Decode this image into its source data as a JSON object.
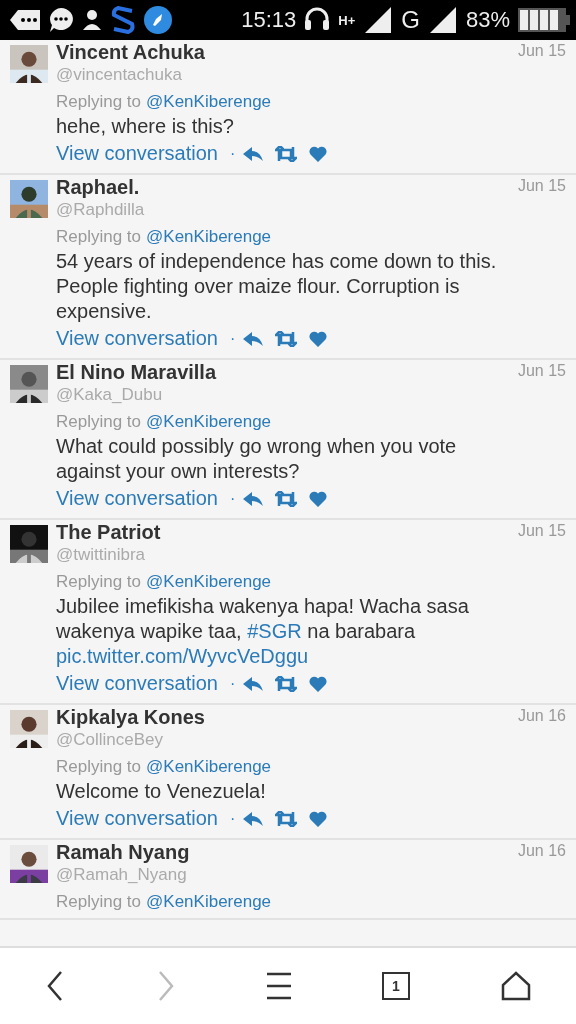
{
  "status_bar": {
    "time": "15:13",
    "network_plus": "H+",
    "network_g": "G",
    "battery": "83%"
  },
  "tweets": [
    {
      "name": "Vincent Achuka",
      "handle": "@vincentachuka",
      "date": "Jun 15",
      "replying_label": "Replying to",
      "replying_to": "@KenKiberenge",
      "body": [
        {
          "kind": "plain",
          "text": "hehe, where is this?"
        }
      ],
      "link": "View conversation"
    },
    {
      "name": "Raphael.",
      "handle": "@Raphdilla",
      "date": "Jun 15",
      "replying_label": "Replying to",
      "replying_to": "@KenKiberenge",
      "body": [
        {
          "kind": "plain",
          "text": "54 years of independence has come down to this. People fighting over maize flour. Corruption is expensive."
        }
      ],
      "link": "View conversation"
    },
    {
      "name": "El Nino Maravilla",
      "handle": "@Kaka_Dubu",
      "date": "Jun 15",
      "replying_label": "Replying to",
      "replying_to": "@KenKiberenge",
      "body": [
        {
          "kind": "plain",
          "text": "What could possibly go wrong when you vote against your own interests?"
        }
      ],
      "link": "View conversation"
    },
    {
      "name": "The Patriot",
      "handle": "@twittinibra",
      "date": "Jun 15",
      "replying_label": "Replying to",
      "replying_to": "@KenKiberenge",
      "body": [
        {
          "kind": "plain",
          "text": "Jubilee imefikisha wakenya hapa! Wacha sasa wakenya wapike taa, "
        },
        {
          "kind": "hashtag",
          "text": "#SGR"
        },
        {
          "kind": "plain",
          "text": " na barabara "
        },
        {
          "kind": "url",
          "text": "pic.twitter.com/WyvcVeDggu"
        }
      ],
      "link": "View conversation"
    },
    {
      "name": "Kipkalya Kones",
      "handle": "@CollinceBey",
      "date": "Jun 16",
      "replying_label": "Replying to",
      "replying_to": "@KenKiberenge",
      "body": [
        {
          "kind": "plain",
          "text": "Welcome to Venezuela!"
        }
      ],
      "link": "View conversation"
    },
    {
      "name": "Ramah Nyang",
      "handle": "@Ramah_Nyang",
      "date": "Jun 16",
      "replying_label": "Replying to",
      "replying_to": "@KenKiberenge"
    }
  ],
  "separator": "·",
  "toolbar": [
    {
      "kind": "back",
      "disabled": false
    },
    {
      "kind": "forward",
      "disabled": true
    },
    {
      "kind": "menu",
      "disabled": false
    },
    {
      "kind": "tabs",
      "count": "1",
      "disabled": false
    },
    {
      "kind": "home",
      "disabled": false
    }
  ]
}
